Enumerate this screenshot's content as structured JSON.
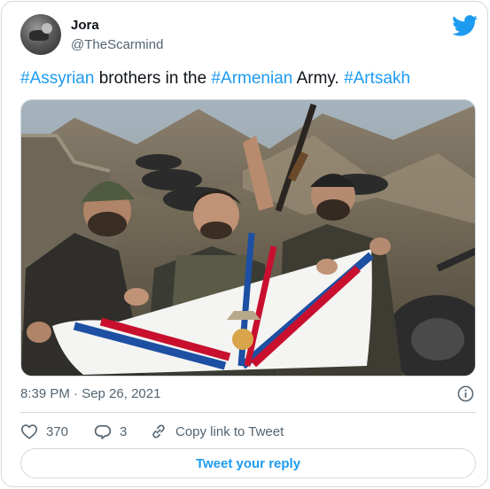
{
  "author": {
    "display_name": "Jora",
    "handle": "@TheScarmind"
  },
  "tweet": {
    "segments": [
      {
        "text": "#Assyrian",
        "hashtag": true
      },
      {
        "text": " brothers in the ",
        "hashtag": false
      },
      {
        "text": "#Armenian",
        "hashtag": true
      },
      {
        "text": " Army. ",
        "hashtag": false
      },
      {
        "text": "#Artsakh",
        "hashtag": true
      }
    ],
    "timestamp": "8:39 PM · Sep 26, 2021"
  },
  "actions": {
    "likes": "370",
    "replies": "3",
    "copy_link_label": "Copy link to Tweet"
  },
  "reply_button_label": "Tweet your reply",
  "colors": {
    "accent": "#1d9bf0",
    "secondary_text": "#536471",
    "border": "#cfd9de",
    "flag_blue": "#1d4fa3",
    "flag_red": "#c8102e",
    "flag_gold": "#d9a54a"
  },
  "icons": {
    "platform": "twitter-bird-icon",
    "like": "heart-icon",
    "reply": "reply-bubble-icon",
    "copy_link": "link-icon",
    "info": "info-icon"
  }
}
